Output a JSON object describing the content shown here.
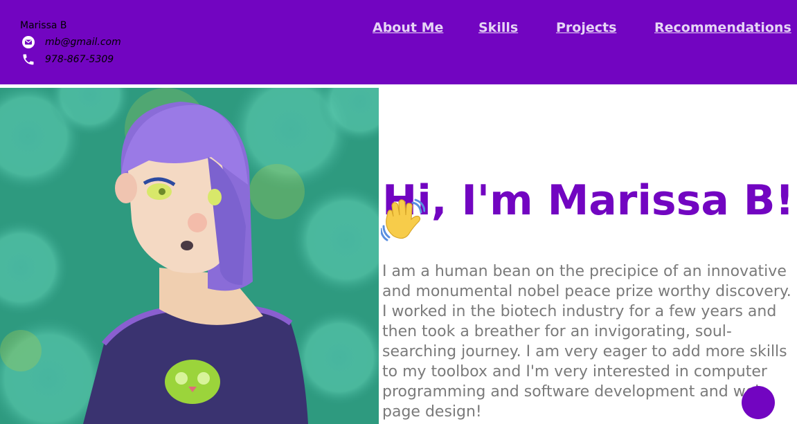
{
  "header": {
    "name": "Marissa B",
    "email": "mb@gmail.com",
    "phone": "978-867-5309",
    "nav": [
      "About Me",
      "Skills",
      "Projects",
      "Recommendations"
    ]
  },
  "main": {
    "heading": "Hi, I'm Marissa B!",
    "bio": "I am a human bean on the precipice of an innovative and monumental nobel peace prize worthy discovery. I worked in the biotech industry for a few years and then took a breather for an invigorating, soul-searching journey. I am very eager to add more skills to my toolbox and I'm very interested in computer programming and software development and web page design!"
  },
  "icons": {
    "email": "mail-icon",
    "phone": "phone-icon",
    "wave": "waving-hand-emoji",
    "fab": "chat-bubble"
  },
  "colors": {
    "brand": "#7205c1",
    "nav_text": "#e6d5f5",
    "body_text": "#7a7a7a"
  }
}
